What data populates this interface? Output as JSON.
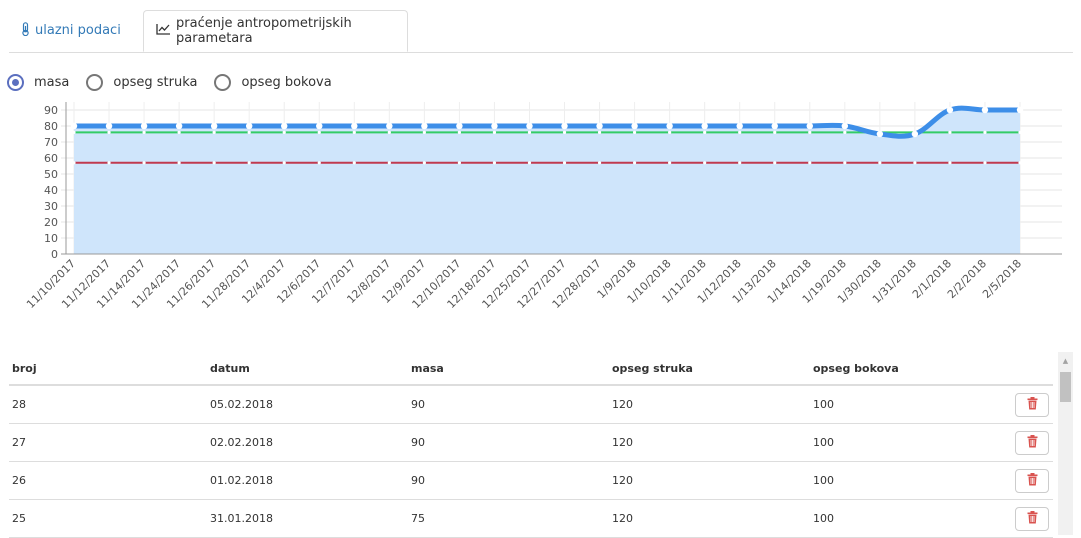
{
  "tabs": [
    {
      "label": "ulazni podaci",
      "icon": "thermometer-icon",
      "active": false
    },
    {
      "label": "praćenje antropometrijskih parametara",
      "icon": "line-chart-icon",
      "active": true
    }
  ],
  "radio_options": [
    {
      "label": "masa",
      "checked": true
    },
    {
      "label": "opseg struka",
      "checked": false
    },
    {
      "label": "opseg bokova",
      "checked": false
    }
  ],
  "colors": {
    "accent": "#337ab7",
    "series_line": "#3d8ee8",
    "area_fill": "#cfe5fb",
    "green_line": "#33cc66",
    "red_line": "#c0394f",
    "delete_icon": "#d9534f"
  },
  "chart_data": {
    "type": "area",
    "x": [
      "11/10/2017",
      "11/12/2017",
      "11/14/2017",
      "11/24/2017",
      "11/26/2017",
      "11/28/2017",
      "12/4/2017",
      "12/6/2017",
      "12/7/2017",
      "12/8/2017",
      "12/9/2017",
      "12/10/2017",
      "12/18/2017",
      "12/25/2017",
      "12/27/2017",
      "12/28/2017",
      "1/9/2018",
      "1/10/2018",
      "1/11/2018",
      "1/12/2018",
      "1/13/2018",
      "1/14/2018",
      "1/19/2018",
      "1/30/2018",
      "1/31/2018",
      "2/1/2018",
      "2/2/2018",
      "2/5/2018"
    ],
    "series": [
      {
        "values": [
          80,
          80,
          80,
          80,
          80,
          80,
          80,
          80,
          80,
          80,
          80,
          80,
          80,
          80,
          80,
          80,
          80,
          80,
          80,
          80,
          80,
          80,
          80,
          75,
          75,
          90,
          90,
          90
        ]
      },
      {
        "values": [
          76,
          76,
          76,
          76,
          76,
          76,
          76,
          76,
          76,
          76,
          76,
          76,
          76,
          76,
          76,
          76,
          76,
          76,
          76,
          76,
          76,
          76,
          76,
          76,
          76,
          76,
          76,
          76
        ]
      },
      {
        "values": [
          57,
          57,
          57,
          57,
          57,
          57,
          57,
          57,
          57,
          57,
          57,
          57,
          57,
          57,
          57,
          57,
          57,
          57,
          57,
          57,
          57,
          57,
          57,
          57,
          57,
          57,
          57,
          57
        ]
      }
    ],
    "y_ticks": [
      0,
      10,
      20,
      30,
      40,
      50,
      60,
      70,
      80,
      90
    ],
    "ylim": [
      0,
      95
    ],
    "grid": true
  },
  "table": {
    "headers": [
      "broj",
      "datum",
      "masa",
      "opseg struka",
      "opseg bokova"
    ],
    "rows": [
      {
        "cells": [
          "28",
          "05.02.2018",
          "90",
          "120",
          "100"
        ]
      },
      {
        "cells": [
          "27",
          "02.02.2018",
          "90",
          "120",
          "100"
        ]
      },
      {
        "cells": [
          "26",
          "01.02.2018",
          "90",
          "120",
          "100"
        ]
      },
      {
        "cells": [
          "25",
          "31.01.2018",
          "75",
          "120",
          "100"
        ]
      }
    ],
    "delete_icon": "trash-icon"
  },
  "scrollbar": {
    "up_arrow_icon": "scroll-up-icon"
  }
}
